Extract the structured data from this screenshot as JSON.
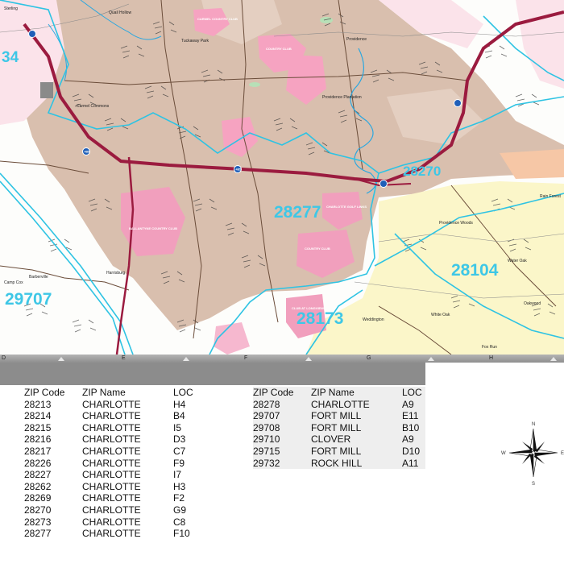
{
  "map": {
    "zip_labels": [
      {
        "code": "34"
      },
      {
        "code": "28277"
      },
      {
        "code": "28270"
      },
      {
        "code": "28104"
      },
      {
        "code": "29707"
      },
      {
        "code": "28173"
      }
    ],
    "places": [
      "Sterling",
      "Quail Hollow",
      "Tuckaway Park",
      "Providence",
      "Providence Plantation",
      "Carmel Commons",
      "Providence Woods",
      "Rain Forest",
      "Water Oak",
      "Oakwood",
      "White Oak",
      "Weddington",
      "Fox Run",
      "Camp Cox",
      "Harrisburg",
      "Barberville"
    ],
    "clubs": [
      "CARMEL COUNTRY CLUB",
      "COUNTRY CLUB",
      "BALLANTYNE COUNTRY CLUB",
      "CHARLOTTE GOLF LINKS",
      "COUNTRY CLUB",
      "CLUB AT LONGVIEW"
    ],
    "interstate": "485",
    "colors": {
      "zip_label": "#3ec7e6",
      "zip_boundary": "#2ec3e3",
      "urban": "#d9bfae",
      "park": "#f19fbd",
      "residential": "#fbf6c9",
      "interstate": "#9b1b3f",
      "water": "#2aa7e0"
    }
  },
  "grid": {
    "columns": [
      "D",
      "E",
      "F",
      "G",
      "H"
    ]
  },
  "table_left": {
    "headers": [
      "ZIP Code",
      "ZIP Name",
      "LOC"
    ],
    "rows": [
      [
        "28213",
        "CHARLOTTE",
        "H4"
      ],
      [
        "28214",
        "CHARLOTTE",
        "B4"
      ],
      [
        "28215",
        "CHARLOTTE",
        "I5"
      ],
      [
        "28216",
        "CHARLOTTE",
        "D3"
      ],
      [
        "28217",
        "CHARLOTTE",
        "C7"
      ],
      [
        "28226",
        "CHARLOTTE",
        "F9"
      ],
      [
        "28227",
        "CHARLOTTE",
        "I7"
      ],
      [
        "28262",
        "CHARLOTTE",
        "H3"
      ],
      [
        "28269",
        "CHARLOTTE",
        "F2"
      ],
      [
        "28270",
        "CHARLOTTE",
        "G9"
      ],
      [
        "28273",
        "CHARLOTTE",
        "C8"
      ],
      [
        "28277",
        "CHARLOTTE",
        "F10"
      ]
    ]
  },
  "table_right": {
    "headers": [
      "ZIP Code",
      "ZIP Name",
      "LOC"
    ],
    "rows": [
      [
        "28278",
        "CHARLOTTE",
        "A9"
      ],
      [
        "29707",
        "FORT MILL",
        "E11"
      ],
      [
        "29708",
        "FORT MILL",
        "B10"
      ],
      [
        "29710",
        "CLOVER",
        "A9"
      ],
      [
        "29715",
        "FORT MILL",
        "D10"
      ],
      [
        "29732",
        "ROCK HILL",
        "A11"
      ]
    ]
  },
  "compass": {
    "n": "N",
    "s": "S",
    "e": "E",
    "w": "W"
  }
}
